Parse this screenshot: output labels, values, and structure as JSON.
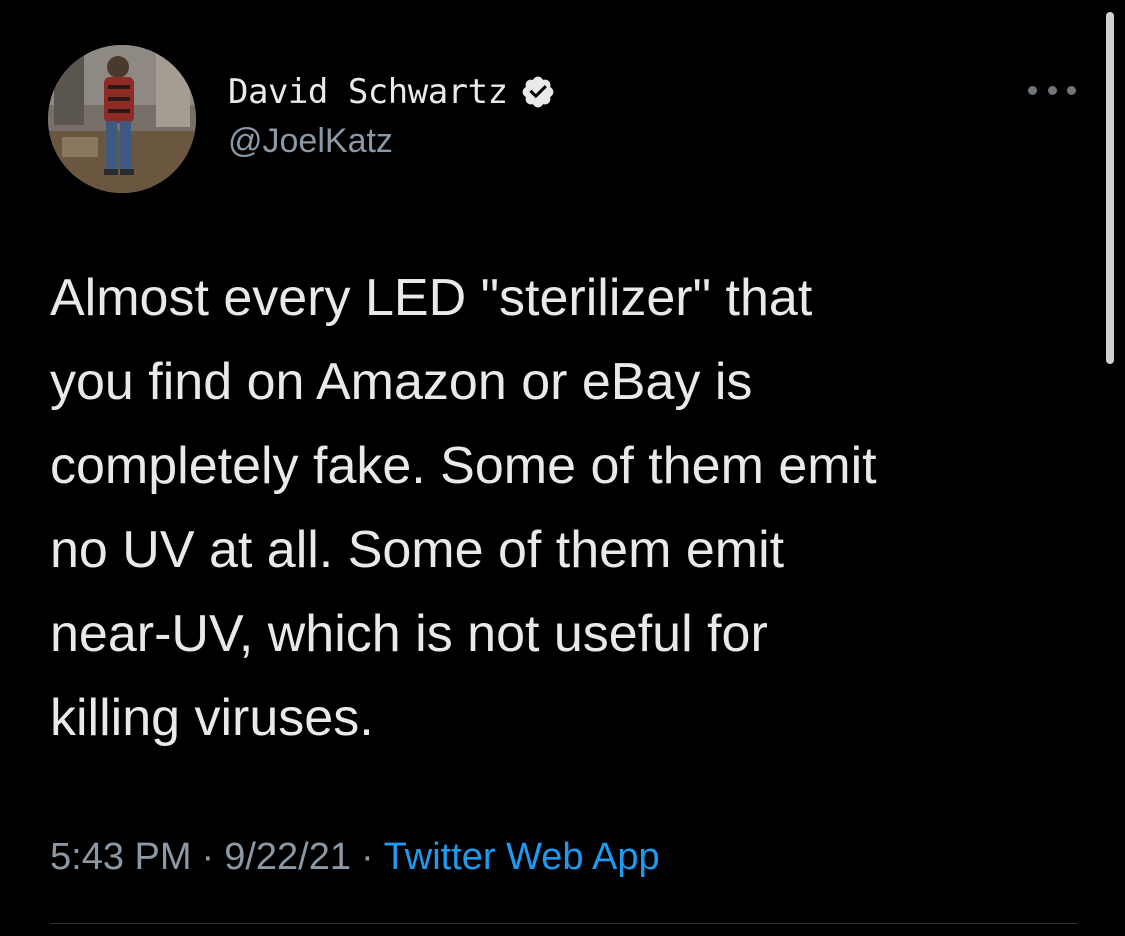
{
  "tweet": {
    "display_name": "David Schwartz",
    "handle": "@JoelKatz",
    "verified": true,
    "body_lines": [
      [
        "Almost every LED ",
        "\"sterilizer\"",
        " that"
      ],
      "you find on Amazon or eBay is",
      "completely fake. Some of them emit",
      "no UV at all. Some of them emit",
      "near-UV, which is not useful for",
      "killing viruses."
    ],
    "time": "5:43 PM",
    "date": "9/22/21",
    "separator": "·",
    "source_app": "Twitter Web App"
  },
  "icons": {
    "verified": "verified-badge-icon",
    "more": "more-options-icon"
  },
  "colors": {
    "background": "#000000",
    "text": "#e7e9ea",
    "secondary_text": "#8b98a5",
    "link": "#1d9bf0",
    "highlight": "#aab228"
  }
}
